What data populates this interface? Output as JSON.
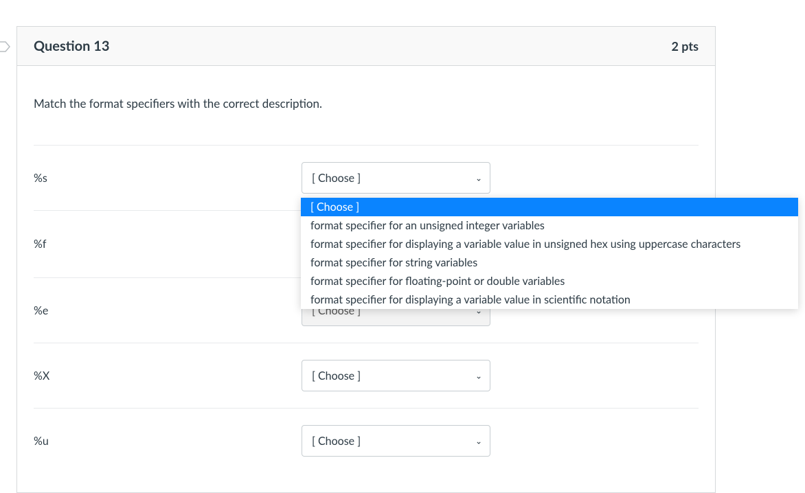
{
  "header": {
    "title": "Question 13",
    "points": "2 pts"
  },
  "prompt": "Match the format specifiers with the correct description.",
  "selectPlaceholder": "[ Choose ]",
  "rows": [
    {
      "label": "%s",
      "value": "[ Choose ]",
      "disabledLook": false
    },
    {
      "label": "%f",
      "value": "",
      "disabledLook": false
    },
    {
      "label": "%e",
      "value": "[ Choose ]",
      "disabledLook": true
    },
    {
      "label": "%X",
      "value": "[ Choose ]",
      "disabledLook": false
    },
    {
      "label": "%u",
      "value": "[ Choose ]",
      "disabledLook": false
    }
  ],
  "dropdown": {
    "options": [
      {
        "text": "[ Choose ]",
        "highlighted": true
      },
      {
        "text": "format specifier for an unsigned integer variables",
        "highlighted": false
      },
      {
        "text": "format specifier for displaying a variable value in unsigned hex using uppercase characters",
        "highlighted": false
      },
      {
        "text": "format specifier for string variables",
        "highlighted": false
      },
      {
        "text": "format specifier for floating-point or double variables",
        "highlighted": false
      },
      {
        "text": "format specifier for displaying a variable value in scientific notation",
        "highlighted": false
      }
    ]
  }
}
